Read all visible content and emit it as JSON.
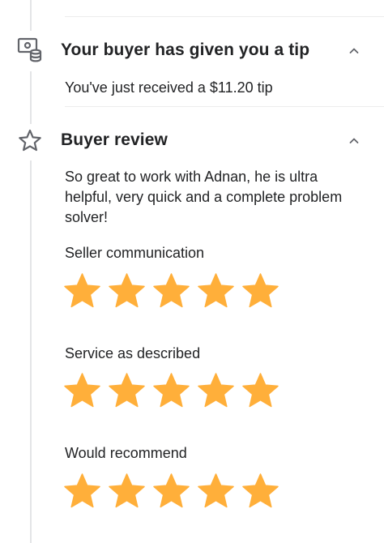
{
  "colors": {
    "star_fill": "#FFAF3A",
    "timeline_line": "#E4E5E7",
    "text_primary": "#222325"
  },
  "tip_section": {
    "icon": "money-tip-icon",
    "title": "Your buyer has given you a tip",
    "message": "You've just received a $11.20 tip",
    "expanded": true
  },
  "review_section": {
    "icon": "star-outline-icon",
    "title": "Buyer review",
    "review_text": "So great to work with Adnan, he is ultra helpful, very quick and a complete problem solver!",
    "expanded": true,
    "criteria": [
      {
        "label": "Seller communication",
        "rating": 5,
        "max": 5
      },
      {
        "label": "Service as described",
        "rating": 5,
        "max": 5
      },
      {
        "label": "Would recommend",
        "rating": 5,
        "max": 5
      }
    ]
  }
}
